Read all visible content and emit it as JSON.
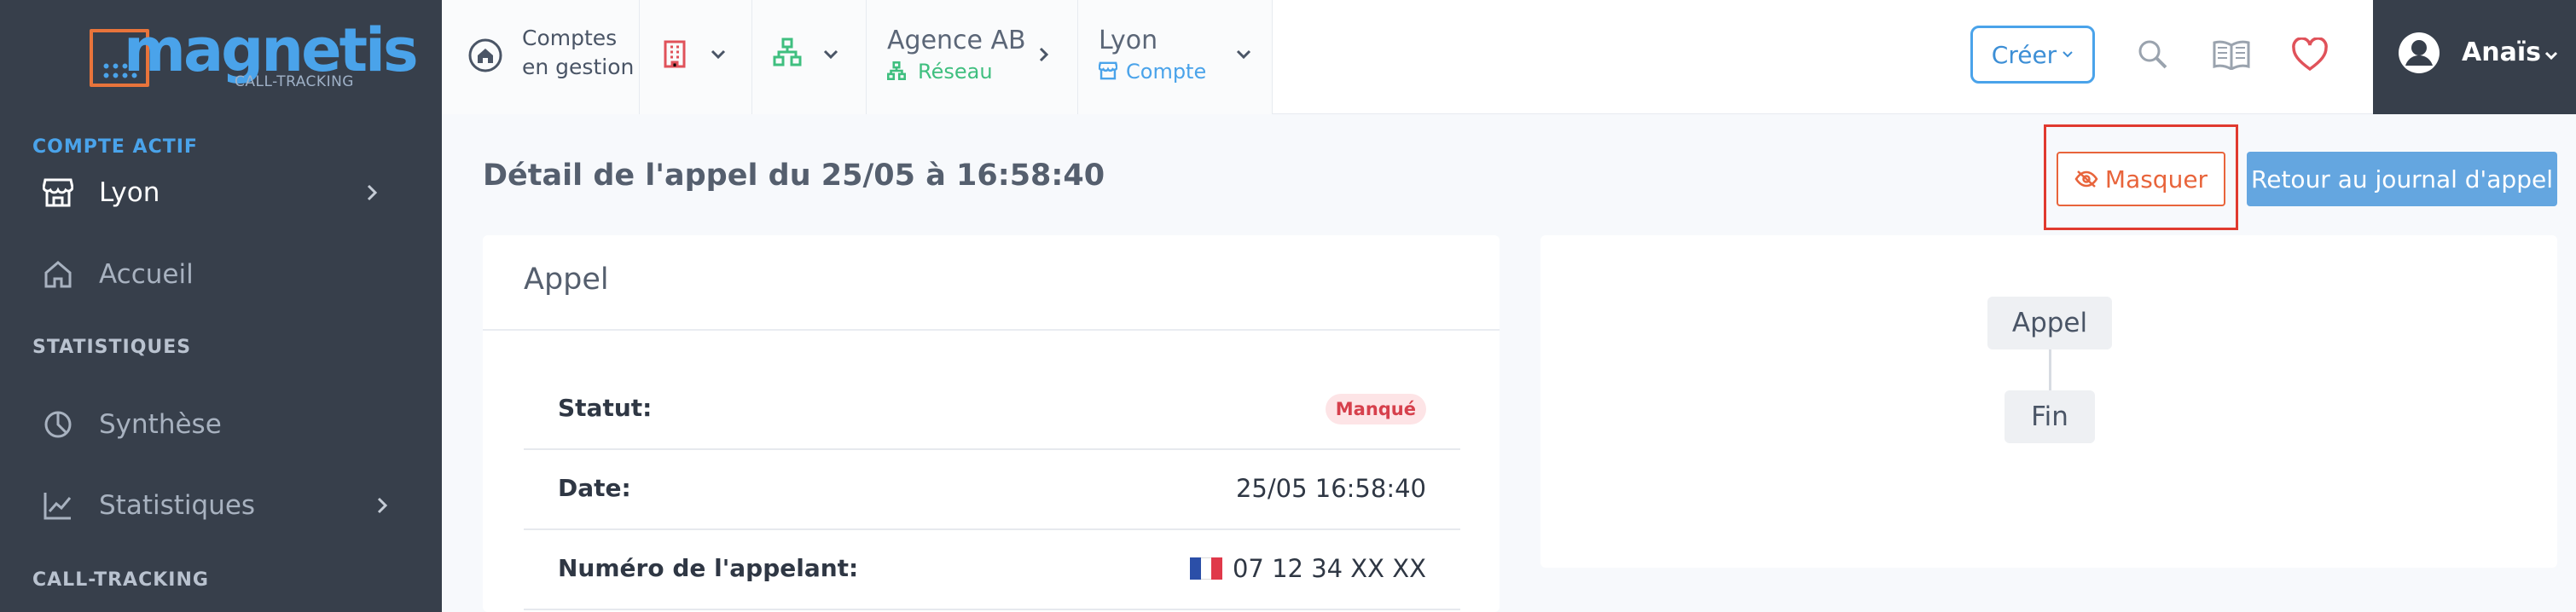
{
  "brand": {
    "name": "magnetis",
    "sub": "CALL-TRACKING"
  },
  "sidebar": {
    "active_section": "COMPTE ACTIF",
    "active_account": "Lyon",
    "home": "Accueil",
    "stats_section": "STATISTIQUES",
    "synthese": "Synthèse",
    "statistiques": "Statistiques",
    "tracking_section": "CALL-TRACKING"
  },
  "topbar": {
    "accounts_line1": "Comptes",
    "accounts_line2": "en gestion",
    "agency": "Agence AB",
    "agency_sub": "Réseau",
    "account": "Lyon",
    "account_sub": "Compte",
    "create": "Créer",
    "user": "Anaïs"
  },
  "main": {
    "title": "Détail de l'appel du 25/05 à 16:58:40",
    "hide_button": "Masquer",
    "back_button": "Retour au journal d'appel"
  },
  "call_card": {
    "title": "Appel",
    "rows": [
      {
        "label": "Statut:",
        "value": "Manqué"
      },
      {
        "label": "Date:",
        "value": "25/05 16:58:40"
      },
      {
        "label": "Numéro de l'appelant:",
        "value": "07 12 34 XX XX"
      }
    ]
  },
  "flow": {
    "start": "Appel",
    "end": "Fin"
  },
  "colors": {
    "accent": "#4aa3ea",
    "danger": "#e8643b",
    "sidebar": "#373f4b",
    "network": "#3fbf7f"
  }
}
